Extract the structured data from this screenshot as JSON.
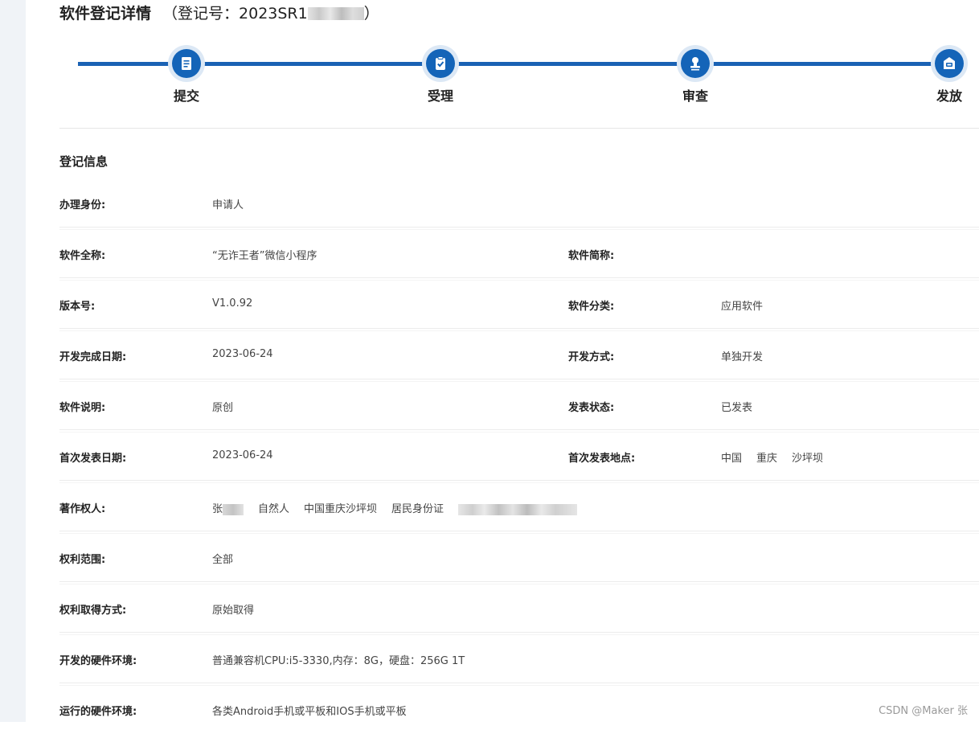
{
  "header": {
    "title": "软件登记详情",
    "reg_prefix": "（登记号：2023SR1",
    "reg_suffix": "）"
  },
  "steps": [
    {
      "label": "提交",
      "icon": "document-icon"
    },
    {
      "label": "受理",
      "icon": "clipboard-check-icon"
    },
    {
      "label": "审查",
      "icon": "stamp-icon"
    },
    {
      "label": "发放",
      "icon": "certificate-box-icon"
    }
  ],
  "colors": {
    "accent": "#1464b8",
    "accent_light": "#dce8f5"
  },
  "section": {
    "title": "登记信息"
  },
  "fields": {
    "identity": {
      "label": "办理身份:",
      "value": "申请人"
    },
    "full_name": {
      "label": "软件全称:",
      "value": "“无诈王者”微信小程序"
    },
    "short_name": {
      "label": "软件简称:",
      "value": ""
    },
    "version": {
      "label": "版本号:",
      "value": "V1.0.92"
    },
    "category": {
      "label": "软件分类:",
      "value": "应用软件"
    },
    "completion_date": {
      "label": "开发完成日期:",
      "value": "2023-06-24"
    },
    "dev_mode": {
      "label": "开发方式:",
      "value": "单独开发"
    },
    "description": {
      "label": "软件说明:",
      "value": "原创"
    },
    "publish_status": {
      "label": "发表状态:",
      "value": "已发表"
    },
    "first_publish_date": {
      "label": "首次发表日期:",
      "value": "2023-06-24"
    },
    "first_publish_place": {
      "label": "首次发表地点:",
      "country": "中国",
      "city": "重庆",
      "district": "沙坪坝"
    },
    "owner": {
      "label": "著作权人:",
      "surname": "张",
      "type": "自然人",
      "location": "中国重庆沙坪坝",
      "id_type": "居民身份证"
    },
    "rights_scope": {
      "label": "权利范围:",
      "value": "全部"
    },
    "rights_acquire": {
      "label": "权利取得方式:",
      "value": "原始取得"
    },
    "dev_hardware": {
      "label": "开发的硬件环境:",
      "value": "普通兼容机CPU:i5-3330,内存：8G，硬盘：256G 1T"
    },
    "run_hardware": {
      "label": "运行的硬件环境:",
      "value": "各类Android手机或平板和IOS手机或平板"
    }
  },
  "watermark": "CSDN @Maker 张"
}
